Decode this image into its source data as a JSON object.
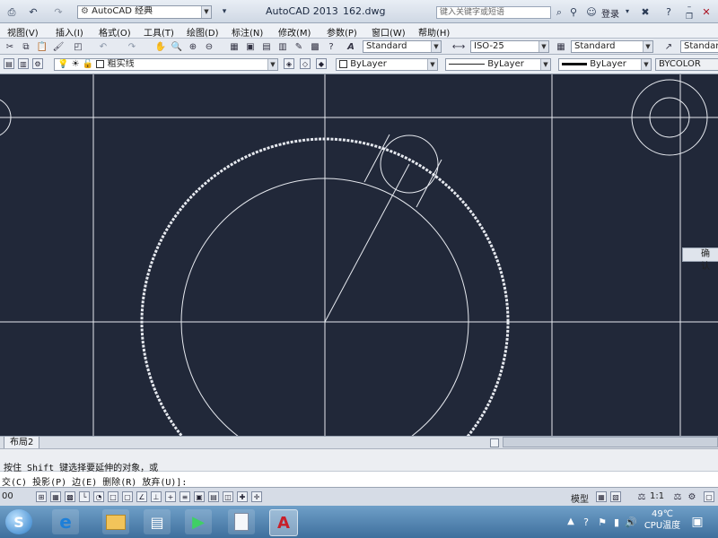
{
  "titlebar": {
    "workspace": "AutoCAD 经典",
    "app_title": "AutoCAD 2013",
    "filename": "162.dwg",
    "search_placeholder": "键入关键字或短语",
    "login": "登录"
  },
  "menu": [
    "视图(V)",
    "插入(I)",
    "格式(O)",
    "工具(T)",
    "绘图(D)",
    "标注(N)",
    "修改(M)",
    "参数(P)",
    "窗口(W)",
    "帮助(H)"
  ],
  "styles": {
    "text_style": "Standard",
    "dim_style": "ISO-25",
    "table_style": "Standard",
    "mleader_style": "Standard"
  },
  "layer_bar": {
    "layer_name": "粗实线",
    "color": "ByLayer",
    "linetype": "ByLayer",
    "lineweight": "ByLayer",
    "plotstyle": "BYCOLOR"
  },
  "canvas": {
    "confirm_label": "确认",
    "bg_color": "#212839",
    "line_color": "#e6e9ef"
  },
  "layout_tabs": {
    "tab_label": "布局2"
  },
  "command": {
    "history_line": "按住 Shift 键选择要延伸的对象，或",
    "prompt_line": "交(C) 投影(P) 边(E) 删除(R) 放弃(U)]:"
  },
  "statusbar": {
    "coord": "00",
    "model_label": "模型",
    "scale": "1:1"
  },
  "taskbar": {
    "temperature": "49℃",
    "cpu_label": "CPU温度"
  }
}
